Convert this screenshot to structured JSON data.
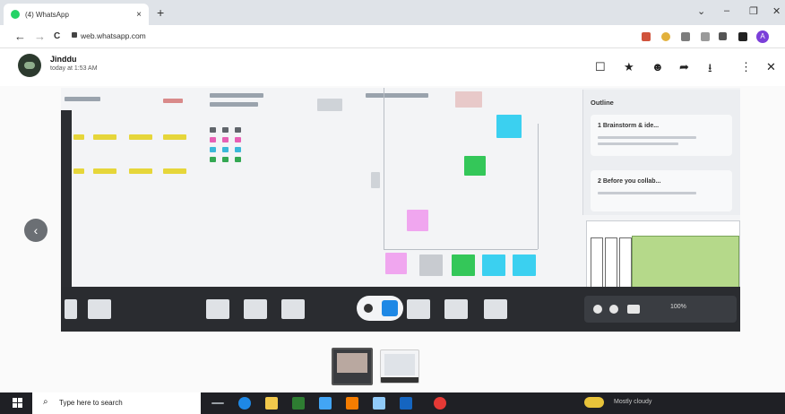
{
  "browser": {
    "tab_title": "(4) WhatsApp",
    "tab_close": "×",
    "new_tab": "+",
    "window_controls": [
      "⌄",
      "–",
      "❐",
      "✕"
    ],
    "url": "web.whatsapp.com",
    "nav": {
      "back": "←",
      "forward": "→",
      "reload": "C"
    },
    "profile_initial": "A"
  },
  "viewer": {
    "contact_name": "Jinddu",
    "timestamp": "today at 1:53 AM",
    "actions": {
      "reply": "☐",
      "star": "★",
      "emoji": "☻",
      "forward": "➦",
      "download": "⭳",
      "menu": "⋮",
      "close": "✕"
    },
    "prev_arrow": "‹"
  },
  "photo": {
    "outline_title": "Outline",
    "outline_items": [
      {
        "label": "1   Brainstorm & ide..."
      },
      {
        "label": "2   Before you collab..."
      }
    ],
    "dock_zoom": "100%"
  },
  "taskbar": {
    "search_placeholder": "Type here to search",
    "search_icon": "⌕",
    "tray_text": "Mostly cloudy"
  },
  "colors": {
    "taskbar_bg": "#1f2025",
    "sticky_yellow": "#e6d63a",
    "sticky_green": "#34c759",
    "sticky_blue": "#3bd0f0",
    "sticky_pink": "#f0a6ef",
    "whatsapp_green": "#25d366"
  }
}
